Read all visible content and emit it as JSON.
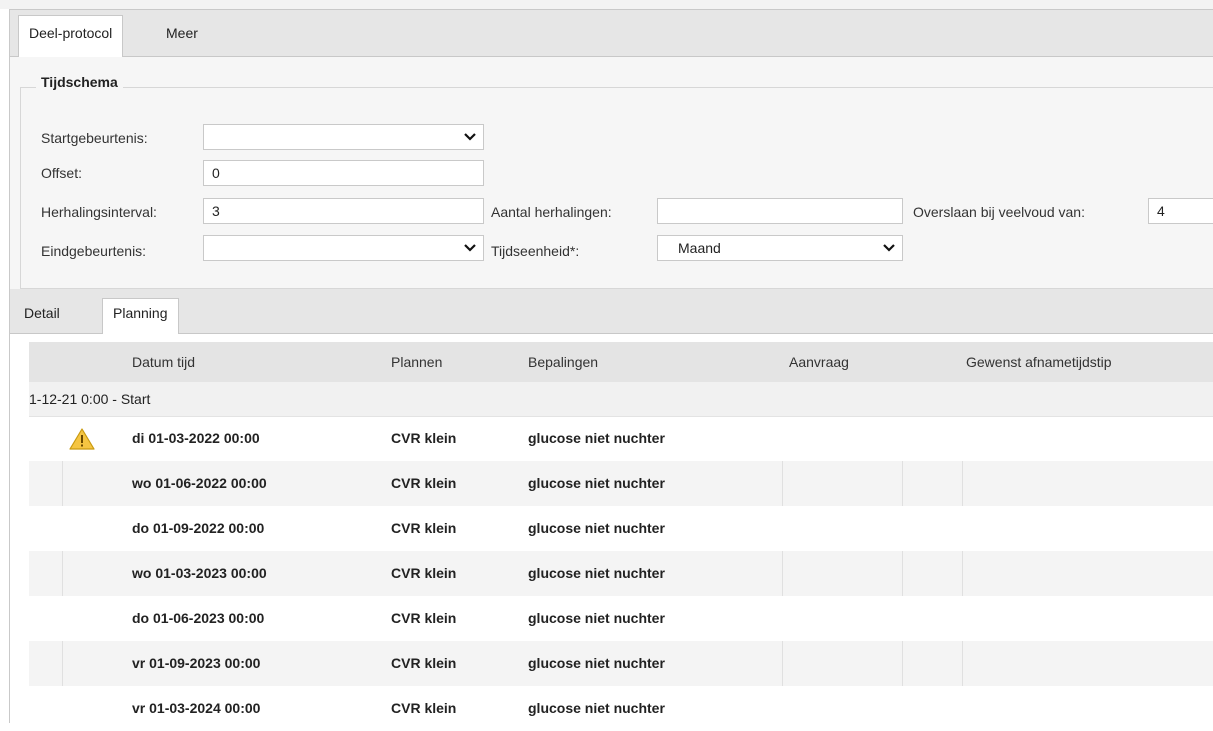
{
  "main_tabs": [
    {
      "label": "Deel-protocol",
      "active": true
    },
    {
      "label": "Meer",
      "active": false
    }
  ],
  "schedule": {
    "legend": "Tijdschema",
    "startgebeurtenis_label": "Startgebeurtenis:",
    "startgebeurtenis_value": "",
    "offset_label": "Offset:",
    "offset_value": "0",
    "herhalingsinterval_label": "Herhalingsinterval:",
    "herhalingsinterval_value": "3",
    "aantal_herhalingen_label": "Aantal herhalingen:",
    "aantal_herhalingen_value": "",
    "overslaan_label": "Overslaan bij veelvoud van:",
    "overslaan_value": "4",
    "eindgebeurtenis_label": "Eindgebeurtenis:",
    "eindgebeurtenis_value": "",
    "tijdseenheid_label": "Tijdseenheid*:",
    "tijdseenheid_value": "Maand"
  },
  "sub_tabs": [
    {
      "label": "Detail",
      "active": false
    },
    {
      "label": "Planning",
      "active": true
    }
  ],
  "grid": {
    "columns": [
      "Datum tijd",
      "Plannen",
      "Bepalingen",
      "Aanvraag",
      "Gewenst afnametijdstip"
    ],
    "group_label": "1-12-21 0:00 - Start",
    "rows": [
      {
        "datum": "di 01-03-2022 00:00",
        "plannen": "CVR klein",
        "bepalingen": "glucose niet nuchter",
        "warning": true
      },
      {
        "datum": "wo 01-06-2022 00:00",
        "plannen": "CVR klein",
        "bepalingen": "glucose niet nuchter",
        "warning": false
      },
      {
        "datum": "do 01-09-2022 00:00",
        "plannen": "CVR klein",
        "bepalingen": "glucose niet nuchter",
        "warning": false
      },
      {
        "datum": "wo 01-03-2023 00:00",
        "plannen": "CVR klein",
        "bepalingen": "glucose niet nuchter",
        "warning": false
      },
      {
        "datum": "do 01-06-2023 00:00",
        "plannen": "CVR klein",
        "bepalingen": "glucose niet nuchter",
        "warning": false
      },
      {
        "datum": "vr 01-09-2023 00:00",
        "plannen": "CVR klein",
        "bepalingen": "glucose niet nuchter",
        "warning": false
      },
      {
        "datum": "vr 01-03-2024 00:00",
        "plannen": "CVR klein",
        "bepalingen": "glucose niet nuchter",
        "warning": false
      }
    ]
  },
  "colors": {
    "tabbar_bg": "#e6e6e6",
    "header_bg": "#e4e4e4",
    "alt_row_bg": "#f4f4f4",
    "warning_fill": "#f5c542"
  }
}
